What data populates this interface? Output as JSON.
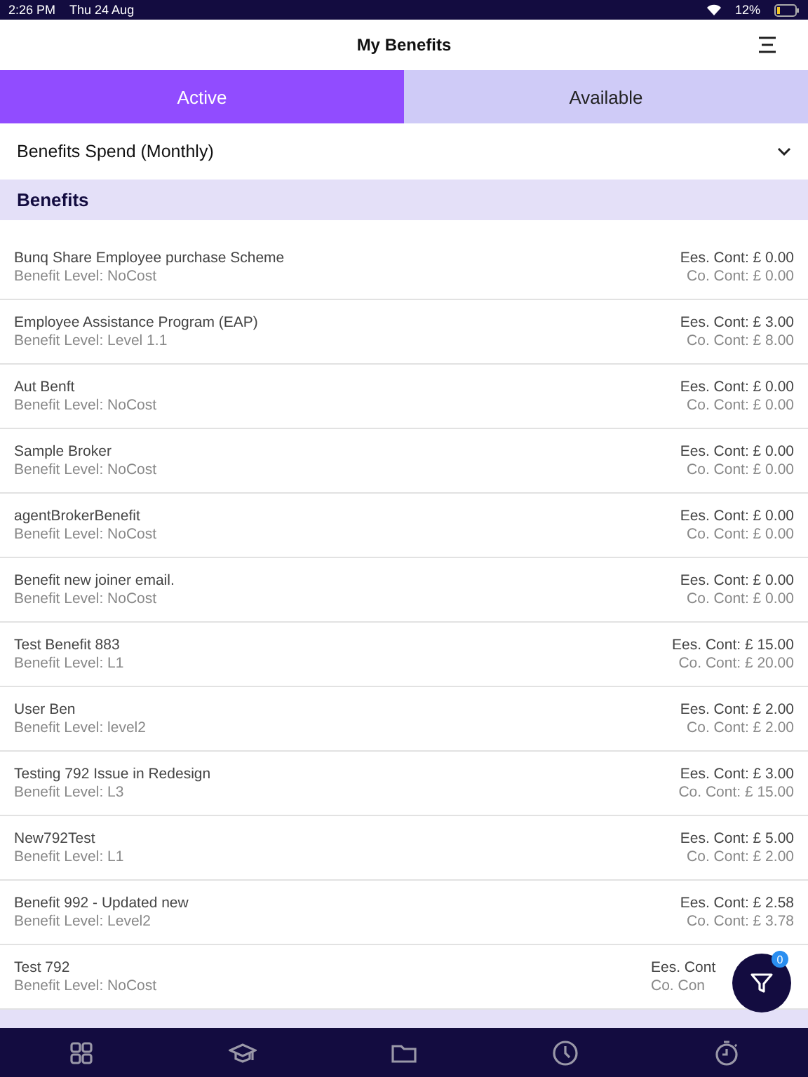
{
  "status_bar": {
    "time": "2:26 PM",
    "date": "Thu 24 Aug",
    "battery": "12%"
  },
  "header": {
    "title": "My Benefits"
  },
  "tabs": [
    {
      "label": "Active",
      "selected": true
    },
    {
      "label": "Available",
      "selected": false
    }
  ],
  "dropdown": {
    "value": "Benefits Spend (Monthly)"
  },
  "section": {
    "title": "Benefits"
  },
  "benefits": [
    {
      "name": "Bunq Share Employee purchase Scheme",
      "level": "Benefit Level: NoCost",
      "ees": "Ees. Cont: £ 0.00",
      "co": "Co. Cont: £ 0.00"
    },
    {
      "name": "Employee Assistance Program (EAP)",
      "level": "Benefit Level: Level 1.1",
      "ees": "Ees. Cont: £ 3.00",
      "co": "Co. Cont: £ 8.00"
    },
    {
      "name": "Aut Benft",
      "level": "Benefit Level: NoCost",
      "ees": "Ees. Cont: £ 0.00",
      "co": "Co. Cont: £ 0.00"
    },
    {
      "name": "Sample Broker",
      "level": "Benefit Level: NoCost",
      "ees": "Ees. Cont: £ 0.00",
      "co": "Co. Cont: £ 0.00"
    },
    {
      "name": "agentBrokerBenefit",
      "level": "Benefit Level: NoCost",
      "ees": "Ees. Cont: £ 0.00",
      "co": "Co. Cont: £ 0.00"
    },
    {
      "name": "Benefit new joiner email.",
      "level": "Benefit Level: NoCost",
      "ees": "Ees. Cont: £ 0.00",
      "co": "Co. Cont: £ 0.00"
    },
    {
      "name": "Test Benefit 883",
      "level": "Benefit Level: L1",
      "ees": "Ees. Cont: £ 15.00",
      "co": "Co. Cont: £ 20.00"
    },
    {
      "name": "User Ben",
      "level": "Benefit Level: level2",
      "ees": "Ees. Cont: £ 2.00",
      "co": "Co. Cont: £ 2.00"
    },
    {
      "name": "Testing 792 Issue in Redesign",
      "level": "Benefit Level: L3",
      "ees": "Ees. Cont: £ 3.00",
      "co": "Co. Cont: £ 15.00"
    },
    {
      "name": "New792Test",
      "level": "Benefit Level: L1",
      "ees": "Ees. Cont: £ 5.00",
      "co": "Co. Cont: £ 2.00"
    },
    {
      "name": "Benefit 992 - Updated new",
      "level": "Benefit Level: Level2",
      "ees": "Ees. Cont: £ 2.58",
      "co": "Co. Cont: £ 3.78"
    },
    {
      "name": "Test 792",
      "level": "Benefit Level: NoCost",
      "ees": "Ees. Cont",
      "co": "Co. Con"
    }
  ],
  "filter_button": {
    "badge": "0"
  }
}
